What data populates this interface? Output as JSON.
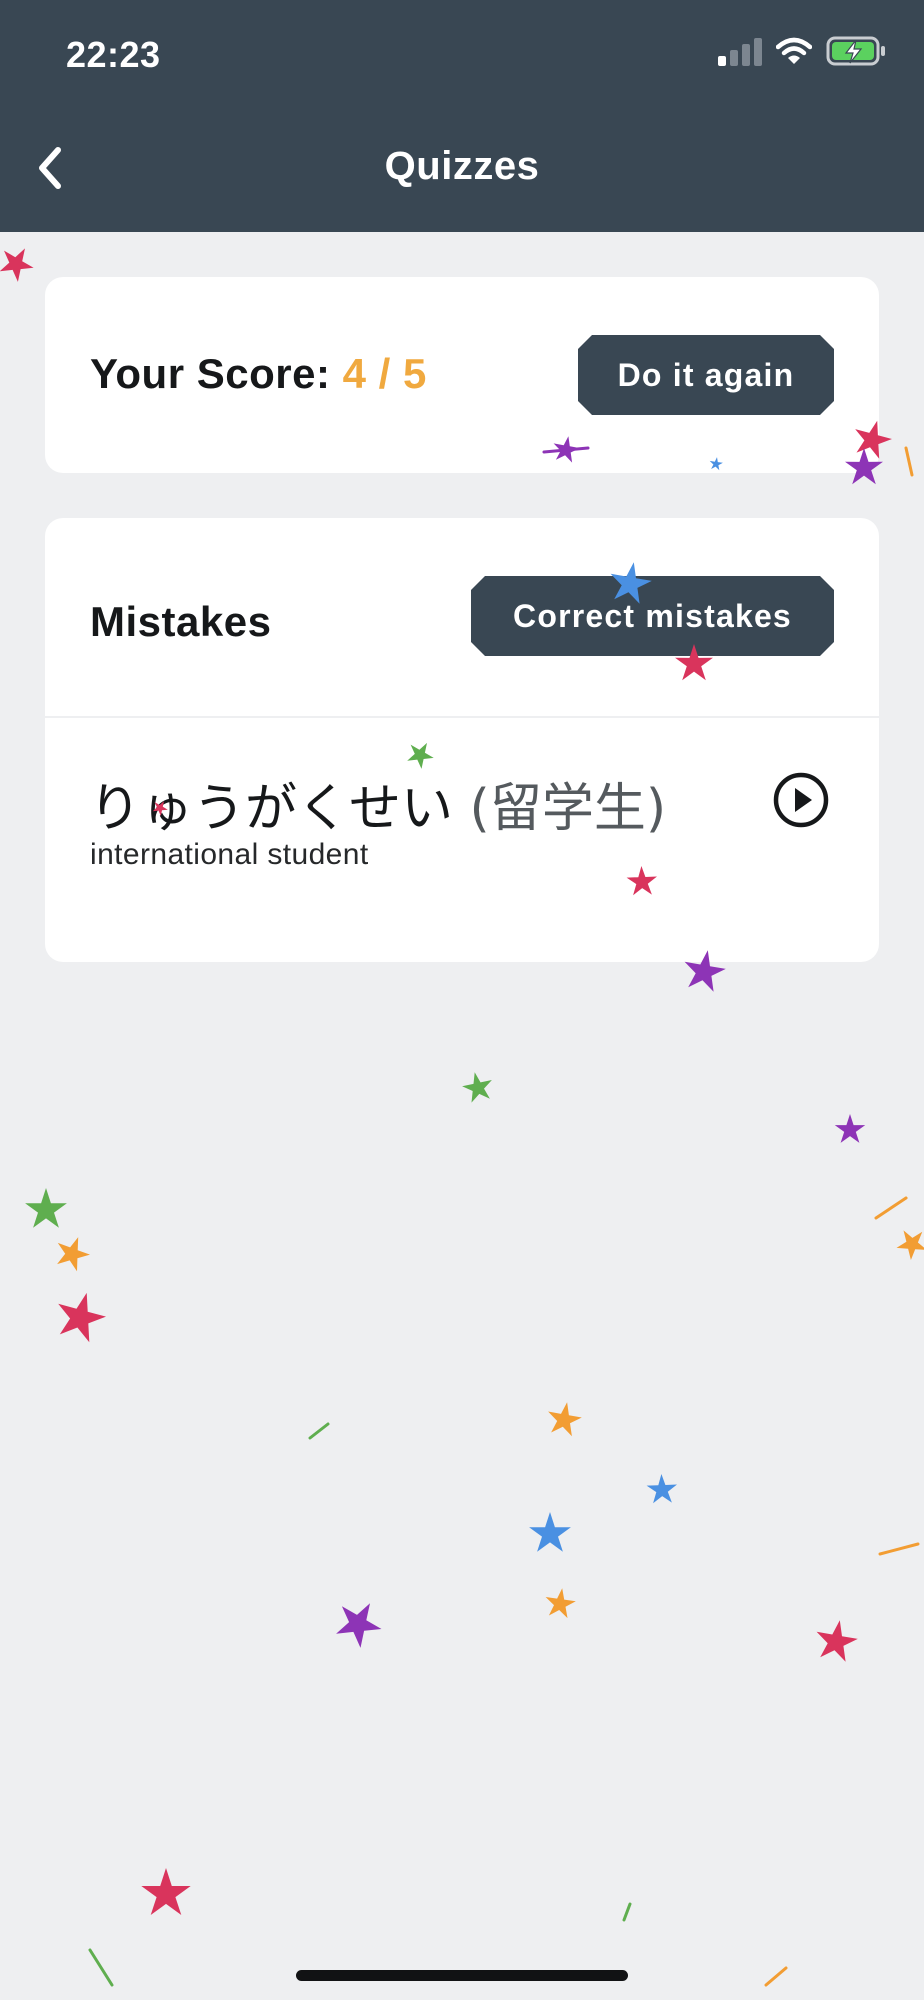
{
  "status_bar": {
    "time": "22:23",
    "icons": [
      "signal-icon",
      "wifi-icon",
      "battery-charging-icon"
    ]
  },
  "header": {
    "title": "Quizzes",
    "back_icon": "chevron-left-icon"
  },
  "score_card": {
    "label": "Your Score: ",
    "score": "4 / 5",
    "score_color": "#f0a93f",
    "button_label": "Do it again"
  },
  "mistakes_card": {
    "title": "Mistakes",
    "button_label": "Correct mistakes",
    "items": [
      {
        "kana": "りゅうがくせい",
        "kanji": " (留学生)",
        "meaning": "international student",
        "play_icon": "play-circle-icon"
      }
    ]
  },
  "colors": {
    "header_bg": "#394753",
    "page_bg": "#eeeff1",
    "button_bg": "#394753",
    "accent": "#f0a93f",
    "confetti": [
      "#d9345c",
      "#8d34b6",
      "#f29d33",
      "#4a90e2",
      "#5fae4f"
    ]
  }
}
